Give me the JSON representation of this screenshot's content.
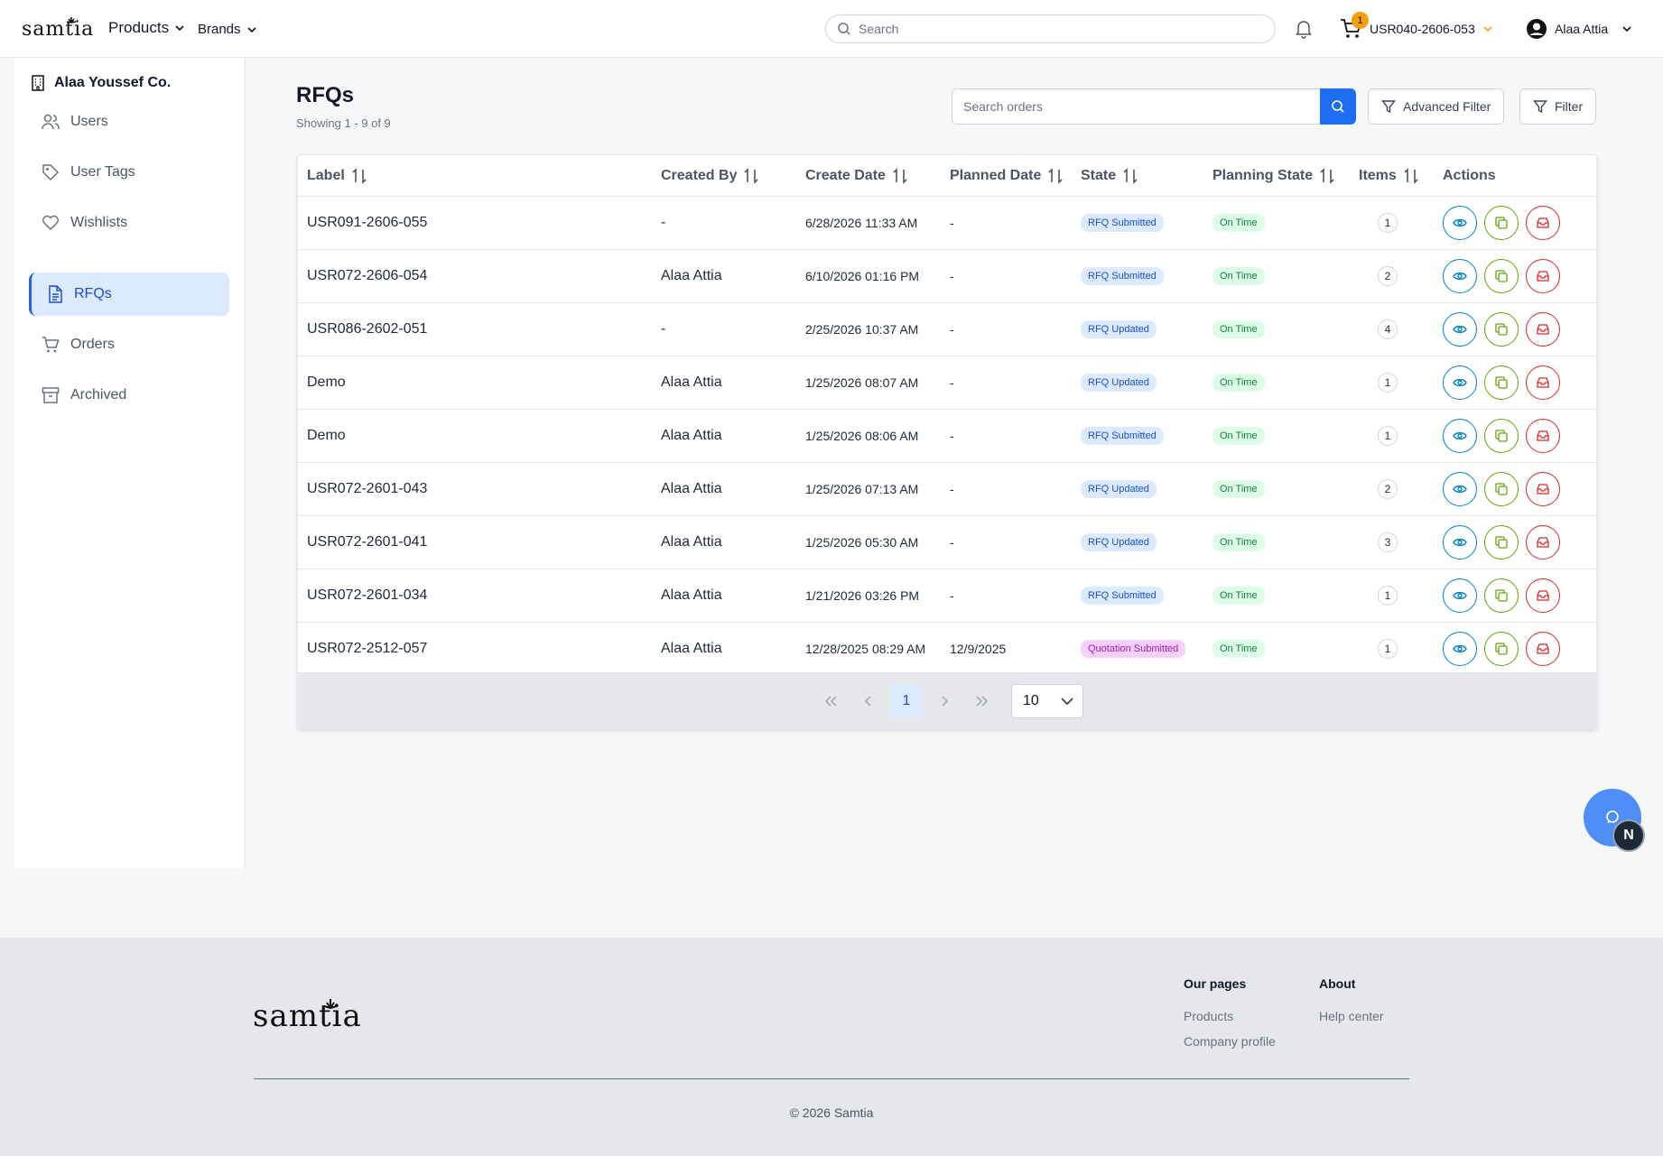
{
  "header": {
    "logo_text": "samtia",
    "products_label": "Products",
    "brands_label": "Brands",
    "search_placeholder": "Search",
    "cart_count": "1",
    "cart_id": "USR040-2606-053",
    "user_name": "Alaa Attia"
  },
  "sidebar": {
    "company": "Alaa Youssef Co.",
    "items": [
      {
        "label": "Users",
        "icon": "users-icon"
      },
      {
        "label": "User Tags",
        "icon": "tag-icon"
      },
      {
        "label": "Wishlists",
        "icon": "heart-icon"
      },
      {
        "label": "RFQs",
        "icon": "document-icon",
        "active": true
      },
      {
        "label": "Orders",
        "icon": "cart-icon"
      },
      {
        "label": "Archived",
        "icon": "archive-icon"
      }
    ]
  },
  "main": {
    "title": "RFQs",
    "showing": "Showing 1 - 9 of 9",
    "search_placeholder": "Search orders",
    "advanced_filter_label": "Advanced Filter",
    "filter_label": "Filter"
  },
  "table": {
    "columns": [
      "Label",
      "Created By",
      "Create Date",
      "Planned Date",
      "State",
      "Planning State",
      "Items",
      "Actions"
    ],
    "rows": [
      {
        "label": "USR091-2606-055",
        "created_by": "-",
        "create_date": "6/28/2026 11:33 AM",
        "planned_date": "-",
        "state": "RFQ Submitted",
        "planning_state": "On Time",
        "items": "1"
      },
      {
        "label": "USR072-2606-054",
        "created_by": "Alaa Attia",
        "create_date": "6/10/2026 01:16 PM",
        "planned_date": "-",
        "state": "RFQ Submitted",
        "planning_state": "On Time",
        "items": "2"
      },
      {
        "label": "USR086-2602-051",
        "created_by": "-",
        "create_date": "2/25/2026 10:37 AM",
        "planned_date": "-",
        "state": "RFQ Updated",
        "planning_state": "On Time",
        "items": "4"
      },
      {
        "label": "Demo",
        "created_by": "Alaa Attia",
        "create_date": "1/25/2026 08:07 AM",
        "planned_date": "-",
        "state": "RFQ Updated",
        "planning_state": "On Time",
        "items": "1"
      },
      {
        "label": "Demo",
        "created_by": "Alaa Attia",
        "create_date": "1/25/2026 08:06 AM",
        "planned_date": "-",
        "state": "RFQ Submitted",
        "planning_state": "On Time",
        "items": "1"
      },
      {
        "label": "USR072-2601-043",
        "created_by": "Alaa Attia",
        "create_date": "1/25/2026 07:13 AM",
        "planned_date": "-",
        "state": "RFQ Updated",
        "planning_state": "On Time",
        "items": "2"
      },
      {
        "label": "USR072-2601-041",
        "created_by": "Alaa Attia",
        "create_date": "1/25/2026 05:30 AM",
        "planned_date": "-",
        "state": "RFQ Updated",
        "planning_state": "On Time",
        "items": "3"
      },
      {
        "label": "USR072-2601-034",
        "created_by": "Alaa Attia",
        "create_date": "1/21/2026 03:26 PM",
        "planned_date": "-",
        "state": "RFQ Submitted",
        "planning_state": "On Time",
        "items": "1"
      },
      {
        "label": "USR072-2512-057",
        "created_by": "Alaa Attia",
        "create_date": "12/28/2025 08:29 AM",
        "planned_date": "12/9/2025",
        "state": "Quotation Submitted",
        "planning_state": "On Time",
        "items": "1"
      }
    ]
  },
  "pagination": {
    "current_page": "1",
    "per_page": "10"
  },
  "chat": {
    "badge_letter": "N"
  },
  "footer": {
    "logo_text": "samtia",
    "col1_title": "Our pages",
    "col1_links": [
      "Products",
      "Company profile"
    ],
    "col2_title": "About",
    "col2_links": [
      "Help center"
    ],
    "copyright": "© 2026 Samtia"
  },
  "colors": {
    "primary": "#1d6ef2",
    "active_nav_bg": "#dbeafe",
    "view_action": "#0284c7",
    "copy_action": "#65a30d",
    "archive_action": "#dc2626",
    "badge_rfq_bg": "#dbeafe",
    "badge_quotation_bg": "#f5d0fe",
    "badge_ontime_bg": "#dcfce7"
  }
}
